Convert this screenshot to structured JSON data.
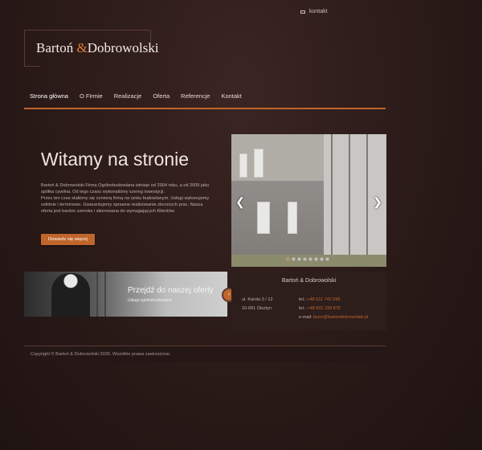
{
  "topbar": {
    "contact_label": "kontakt"
  },
  "logo": {
    "part1": "Bartoń ",
    "amp": "&",
    "part2": "Dobrowolski"
  },
  "nav": {
    "items": [
      {
        "label": "Strona główna"
      },
      {
        "label": "O Firmie"
      },
      {
        "label": "Realizacje"
      },
      {
        "label": "Oferta"
      },
      {
        "label": "Referencje"
      },
      {
        "label": "Kontakt"
      }
    ],
    "active_index": 0
  },
  "hero": {
    "title": "Witamy na stronie",
    "paragraphs": [
      "Bartoń & Dobrowolski Firma Ogólnobudowlana istnieje od 2004 roku, a od 2005 jako spółka cywilna. Od tego czasu wykonaliśmy szereg inwestycji.",
      "Przez ten czas staliśmy się cenioną firmą na rynku budowlanym. Usługi wykonujemy solidnie i terminowo. Gwarantujemy sprawne realizowanie zleconych prac. Nasza oferta jest bardzo szeroka i skierowana do wymagających Klientów."
    ],
    "button_label": "Dowiedz się więcej"
  },
  "slider": {
    "prev": "❮",
    "next": "❯",
    "slide_count": 8,
    "current": 1
  },
  "offer": {
    "title": "Przejdź do naszej oferty",
    "subtitle": "Usługi ogólnobudowlane.",
    "button_icon": "›"
  },
  "contact": {
    "title": "Bartoń & Dobrowolski",
    "address1": "ul. Karola 3 / 12",
    "address2": "10-691 Olsztyn",
    "tel1_label": "tel.:",
    "tel1": "+48 511 742 596",
    "tel2_label": "tel.:",
    "tel2": "+48 501 239 875",
    "email_label": "e-mail:",
    "email": "biuro@bartondobrowolski.pl"
  },
  "footer": {
    "copyright": "Copyright © Bartoń & Dobrowolski 2026. Wszelkie prawa zastrzeżone."
  },
  "colors": {
    "accent": "#c0652c",
    "background": "#2a1a18"
  }
}
